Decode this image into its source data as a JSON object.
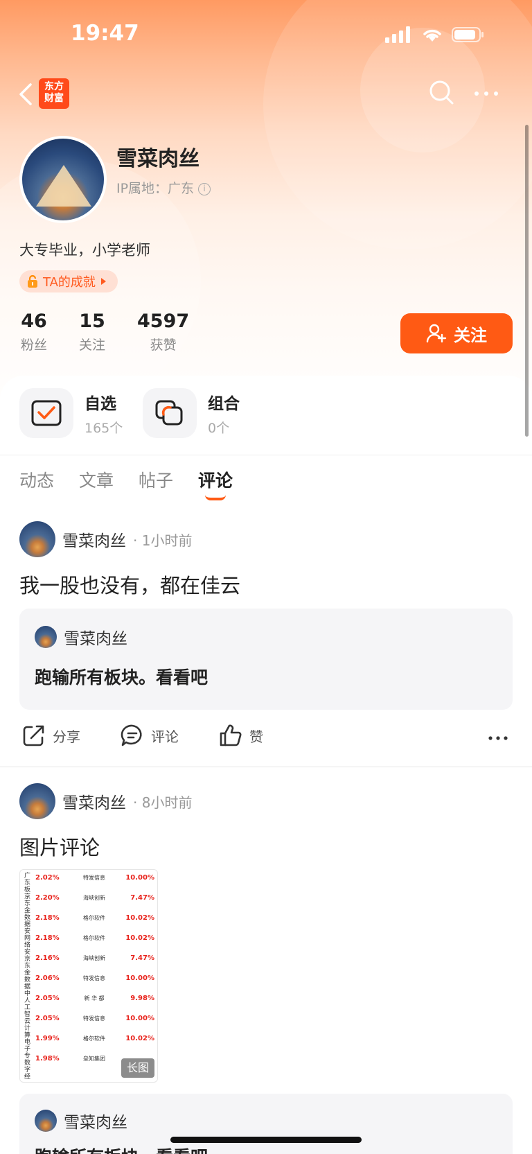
{
  "status_bar": {
    "time": "19:47"
  },
  "header": {
    "logo_line1": "东方",
    "logo_line2": "财富"
  },
  "profile": {
    "name": "雪菜肉丝",
    "ip_label": "IP属地：广东",
    "bio": "大专毕业，小学老师",
    "achievement": "TA的成就",
    "stats": [
      {
        "num": "46",
        "label": "粉丝"
      },
      {
        "num": "15",
        "label": "关注"
      },
      {
        "num": "4597",
        "label": "获赞"
      }
    ],
    "follow_label": "关注"
  },
  "entries": {
    "watchlist": {
      "title": "自选",
      "sub": "165个"
    },
    "portfolio": {
      "title": "组合",
      "sub": "0个"
    }
  },
  "tabs": [
    {
      "label": "动态"
    },
    {
      "label": "文章"
    },
    {
      "label": "帖子"
    },
    {
      "label": "评论"
    }
  ],
  "posts": [
    {
      "author": "雪菜肉丝",
      "time": "· 1小时前",
      "text": "我一股也没有，都在佳云",
      "quote_author": "雪菜肉丝",
      "quote_text": "跑输所有板块。看看吧"
    },
    {
      "author": "雪菜肉丝",
      "time": "· 8小时前",
      "text": "图片评论",
      "image_tag": "长图",
      "quote_author": "雪菜肉丝",
      "quote_text": "跑输所有板块。看看吧"
    }
  ],
  "image_preview": {
    "left_text": "广东板京东金数据安网络安京东金数据中人工智云计算电子专数字经",
    "rows": [
      {
        "pct": "2.02%",
        "name": "特发信息",
        "pct2": "10.00%"
      },
      {
        "pct": "2.20%",
        "name": "海峡创新",
        "pct2": "7.47%"
      },
      {
        "pct": "2.18%",
        "name": "格尔软件",
        "pct2": "10.02%"
      },
      {
        "pct": "2.18%",
        "name": "格尔软件",
        "pct2": "10.02%"
      },
      {
        "pct": "2.16%",
        "name": "海峡创新",
        "pct2": "7.47%"
      },
      {
        "pct": "2.06%",
        "name": "特发信息",
        "pct2": "10.00%"
      },
      {
        "pct": "2.05%",
        "name": "新 华 都",
        "pct2": "9.98%"
      },
      {
        "pct": "2.05%",
        "name": "特发信息",
        "pct2": "10.00%"
      },
      {
        "pct": "1.99%",
        "name": "格尔软件",
        "pct2": "10.02%"
      },
      {
        "pct": "1.98%",
        "name": "垒知集团",
        "pct2": ""
      }
    ]
  },
  "actions": {
    "share": "分享",
    "comment": "评论",
    "like": "赞"
  },
  "colors": {
    "accent": "#ff5a14",
    "header_top": "#ff9a62",
    "red": "#e8221b"
  }
}
